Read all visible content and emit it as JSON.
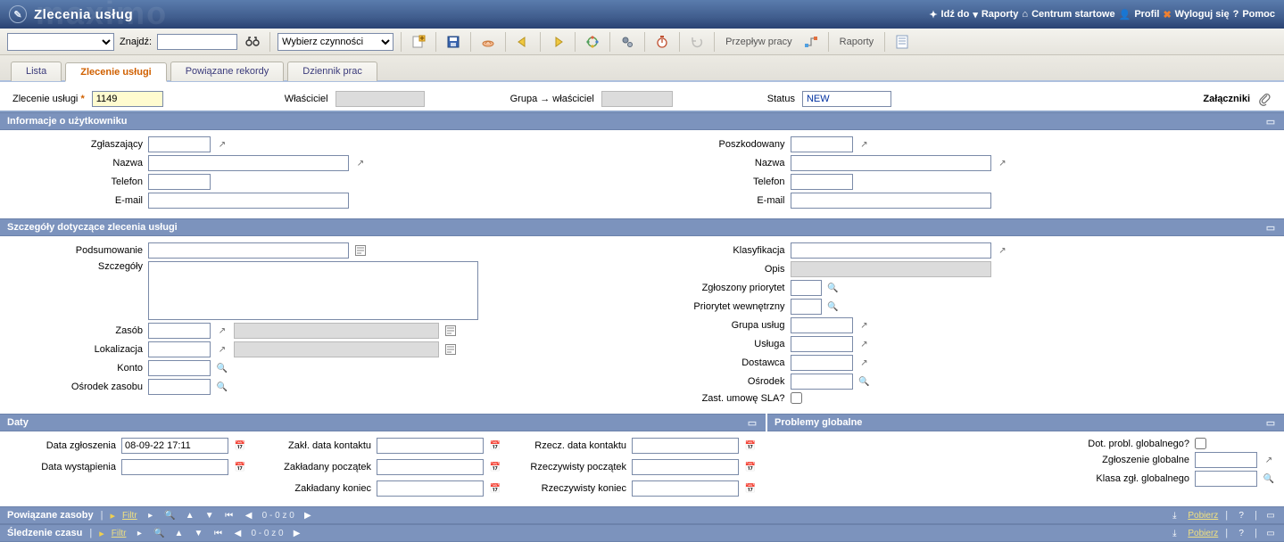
{
  "app": {
    "title": "Zlecenia usług",
    "ghost": "maximo"
  },
  "topnav": {
    "goto": "Idź do",
    "reports": "Raporty",
    "start": "Centrum startowe",
    "profile": "Profil",
    "logout": "Wyloguj się",
    "help": "Pomoc"
  },
  "toolbar": {
    "find_label": "Znajdź:",
    "action_placeholder": "Wybierz czynności",
    "workflow": "Przepływ pracy",
    "reports": "Raporty"
  },
  "tabs": {
    "list": "Lista",
    "sr": "Zlecenie usługi",
    "related": "Powiązane rekordy",
    "log": "Dziennik prac"
  },
  "header": {
    "sr_label": "Zlecenie usługi",
    "sr_value": "1149",
    "owner_label": "Właściciel",
    "ownergroup_label": "Grupa → właściciel",
    "status_label": "Status",
    "status_value": "NEW",
    "attachments_label": "Załączniki"
  },
  "sections": {
    "user_info": "Informacje o użytkowniku",
    "sr_details": "Szczegóły dotyczące zlecenia usługi",
    "dates": "Daty",
    "global": "Problemy globalne",
    "related_assets": "Powiązane zasoby",
    "time_track": "Śledzenie czasu"
  },
  "user": {
    "reportedby": "Zgłaszający",
    "name": "Nazwa",
    "phone": "Telefon",
    "email": "E-mail",
    "affected": "Poszkodowany"
  },
  "details": {
    "summary": "Podsumowanie",
    "details": "Szczegóły",
    "asset": "Zasób",
    "location": "Lokalizacja",
    "account": "Konto",
    "assetsite": "Ośrodek zasobu",
    "classification": "Klasyfikacja",
    "description": "Opis",
    "reported_priority": "Zgłoszony priorytet",
    "internal_priority": "Priorytet wewnętrzny",
    "service_group": "Grupa usług",
    "service": "Usługa",
    "vendor": "Dostawca",
    "site": "Ośrodek",
    "apply_sla": "Zast. umowę SLA?"
  },
  "dates": {
    "reported": "Data zgłoszenia",
    "reported_val": "08-09-22 17:11",
    "occurred": "Data wystąpienia",
    "target_contact": "Zakł. data kontaktu",
    "target_start": "Zakładany początek",
    "target_finish": "Zakładany koniec",
    "actual_contact": "Rzecz. data kontaktu",
    "actual_start": "Rzeczywisty początek",
    "actual_finish": "Rzeczywisty koniec"
  },
  "global": {
    "isglobal": "Dot. probl. globalnego?",
    "global_ticket": "Zgłoszenie globalne",
    "global_class": "Klasa zgł. globalnego"
  },
  "table": {
    "filter": "Filtr",
    "pager": "0 - 0 z 0",
    "download": "Pobierz"
  }
}
